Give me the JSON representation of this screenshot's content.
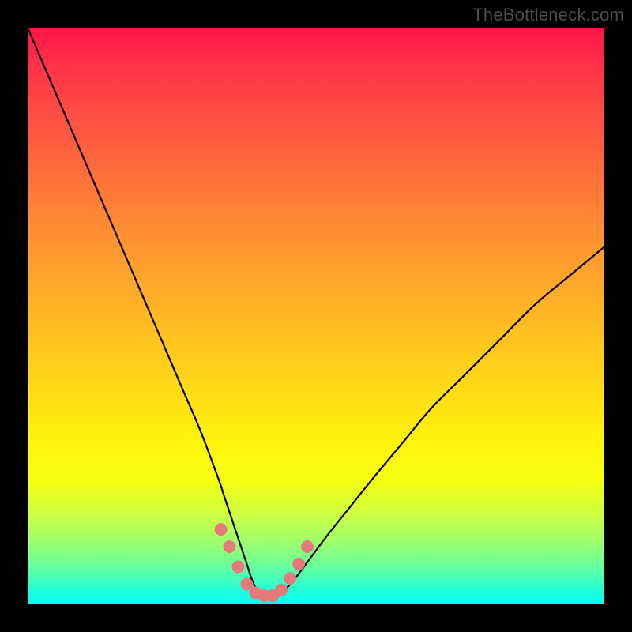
{
  "watermark": "TheBottleneck.com",
  "colors": {
    "background": "#000000",
    "curve": "#000000",
    "marker_fill": "#e47a7a",
    "marker_stroke": "#d55f5f"
  },
  "chart_data": {
    "type": "line",
    "title": "",
    "xlabel": "",
    "ylabel": "",
    "xlim": [
      0,
      100
    ],
    "ylim": [
      0,
      100
    ],
    "grid": false,
    "legend": false,
    "series": [
      {
        "name": "bottleneck-curve",
        "x": [
          0,
          3,
          6,
          9,
          12,
          15,
          18,
          21,
          24,
          27,
          30,
          33,
          34,
          35,
          36,
          37,
          38,
          39,
          40,
          41,
          42,
          43,
          44,
          46,
          49,
          52,
          56,
          60,
          65,
          70,
          76,
          82,
          88,
          94,
          100
        ],
        "values": [
          100,
          93,
          86,
          79,
          72,
          65,
          58,
          51,
          44,
          37,
          30,
          22,
          19,
          16,
          13,
          10,
          7,
          4,
          2,
          1,
          1,
          1,
          2,
          4,
          8,
          12,
          17,
          22,
          28,
          34,
          40,
          46,
          52,
          57,
          62
        ]
      }
    ],
    "markers": {
      "name": "highlight-dots",
      "x": [
        33.5,
        35.0,
        36.5,
        38.0,
        39.5,
        41.0,
        42.5,
        44.0,
        45.5,
        47.0,
        48.5
      ],
      "values": [
        13.0,
        10.0,
        6.5,
        3.5,
        2.0,
        1.5,
        1.5,
        2.5,
        4.5,
        7.0,
        10.0
      ],
      "radius": 8
    }
  }
}
